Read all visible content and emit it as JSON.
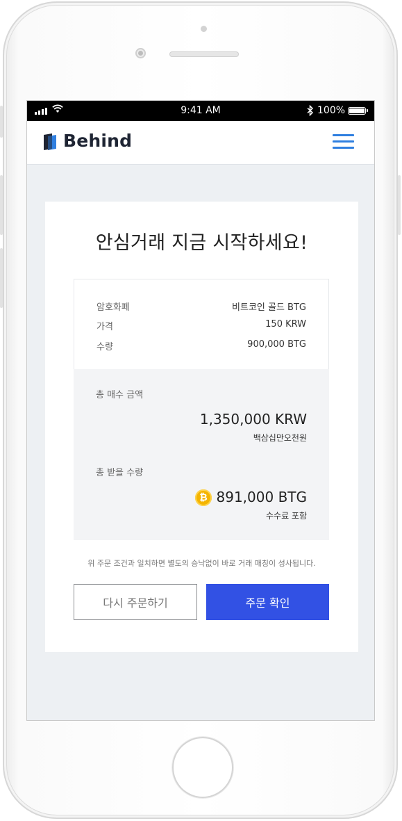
{
  "status_bar": {
    "time": "9:41 AM",
    "battery": "100%",
    "icons": [
      "signal-icon",
      "wifi-icon",
      "bluetooth-icon",
      "battery-icon"
    ]
  },
  "header": {
    "logo_text": "Behind",
    "menu_icon": "hamburger-menu-icon",
    "accent_color": "#2f7fe0"
  },
  "order": {
    "headline": "안심거래 지금 시작하세요!",
    "details": [
      {
        "label": "암호화폐",
        "value": "비트코인 골드 BTG"
      },
      {
        "label": "가격",
        "value": "150 KRW"
      },
      {
        "label": "수량",
        "value": "900,000 BTG"
      }
    ],
    "total_purchase": {
      "label": "총 매수 금액",
      "amount": "1,350,000 KRW",
      "amount_korean": "백삼십만오천원"
    },
    "total_receive": {
      "label": "총 받을 수량",
      "coin_icon": "bitcoin-coin-icon",
      "amount": "891,000 BTG",
      "note": "수수료 포함"
    },
    "notice": "위 주문 조건과 일치하면 별도의 승낙없이 바로 거래 매칭이 성사됩니다.",
    "buttons": {
      "reorder": "다시 주문하기",
      "confirm": "주문 확인"
    },
    "confirm_color": "#3251e4"
  }
}
